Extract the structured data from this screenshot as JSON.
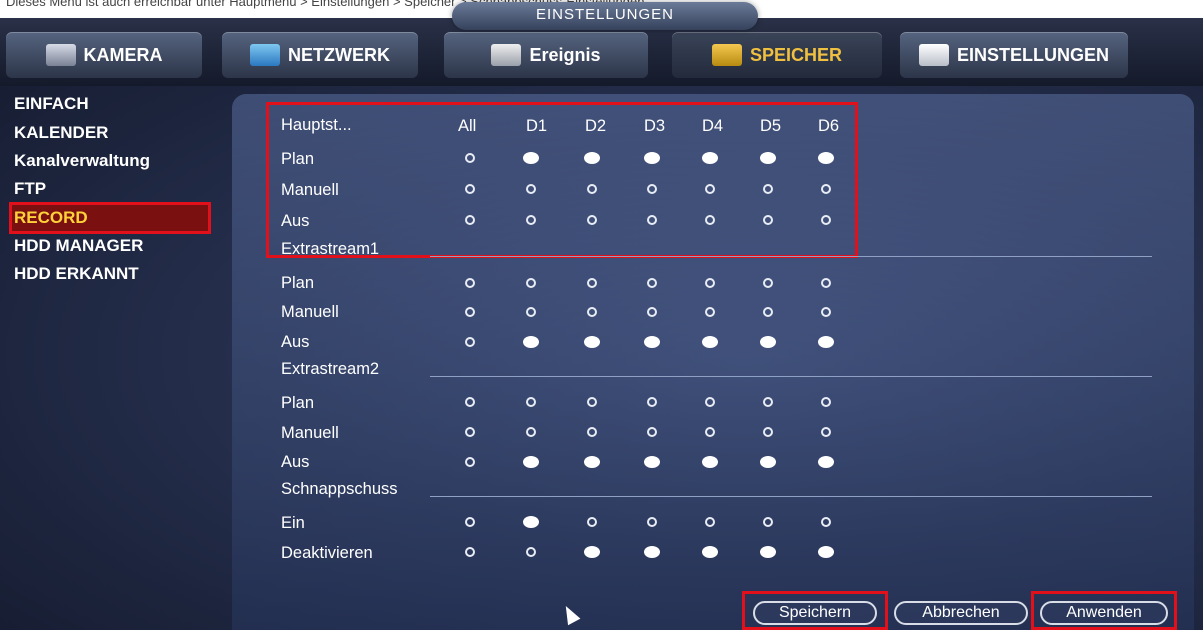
{
  "caption": "Dieses Menü ist auch erreichbar unter Hauptmenü > Einstellungen > Speicher > Schnappschuss-Einstellungen",
  "window_title": "EINSTELLUNGEN",
  "tabs": [
    {
      "label": "KAMERA",
      "icon": "camera-icon"
    },
    {
      "label": "NETZWERK",
      "icon": "network-icon"
    },
    {
      "label": "Ereignis",
      "icon": "event-icon"
    },
    {
      "label": "SPEICHER",
      "icon": "storage-icon",
      "active": true
    },
    {
      "label": "EINSTELLUNGEN",
      "icon": "settings-icon"
    }
  ],
  "sidebar": [
    {
      "label": "EINFACH"
    },
    {
      "label": "KALENDER"
    },
    {
      "label": "Kanalverwaltung"
    },
    {
      "label": "FTP"
    },
    {
      "label": "RECORD",
      "active": true
    },
    {
      "label": "HDD MANAGER"
    },
    {
      "label": "HDD ERKANNT"
    }
  ],
  "columns": [
    "All",
    "D1",
    "D2",
    "D3",
    "D4",
    "D5",
    "D6"
  ],
  "sections": [
    {
      "title": "Hauptst...",
      "rows": [
        {
          "label": "Plan",
          "values": [
            false,
            true,
            true,
            true,
            true,
            true,
            true
          ]
        },
        {
          "label": "Manuell",
          "values": [
            false,
            false,
            false,
            false,
            false,
            false,
            false
          ]
        },
        {
          "label": "Aus",
          "values": [
            false,
            false,
            false,
            false,
            false,
            false,
            false
          ]
        }
      ]
    },
    {
      "title": "Extrastream1",
      "rows": [
        {
          "label": "Plan",
          "values": [
            false,
            false,
            false,
            false,
            false,
            false,
            false
          ]
        },
        {
          "label": "Manuell",
          "values": [
            false,
            false,
            false,
            false,
            false,
            false,
            false
          ]
        },
        {
          "label": "Aus",
          "values": [
            false,
            true,
            true,
            true,
            true,
            true,
            true
          ]
        }
      ]
    },
    {
      "title": "Extrastream2",
      "rows": [
        {
          "label": "Plan",
          "values": [
            false,
            false,
            false,
            false,
            false,
            false,
            false
          ]
        },
        {
          "label": "Manuell",
          "values": [
            false,
            false,
            false,
            false,
            false,
            false,
            false
          ]
        },
        {
          "label": "Aus",
          "values": [
            false,
            true,
            true,
            true,
            true,
            true,
            true
          ]
        }
      ]
    },
    {
      "title": "Schnappschuss",
      "rows": [
        {
          "label": "Ein",
          "values": [
            false,
            true,
            false,
            false,
            false,
            false,
            false
          ]
        },
        {
          "label": "Deaktivieren",
          "values": [
            false,
            false,
            true,
            true,
            true,
            true,
            true
          ]
        }
      ]
    }
  ],
  "buttons": {
    "save": "Speichern",
    "cancel": "Abbrechen",
    "apply": "Anwenden"
  },
  "colors": {
    "highlight": "#e2101a",
    "active_text": "#ffd23a"
  }
}
